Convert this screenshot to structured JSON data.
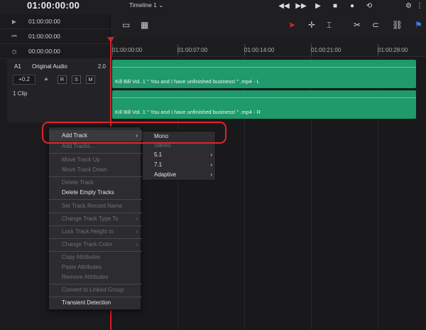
{
  "topbar": {
    "timecode": "01:00:00:00",
    "timeline_name": "Timeline 1",
    "transport": [
      "prev",
      "next",
      "play",
      "stop",
      "record",
      "loop"
    ]
  },
  "left": {
    "timecodes": [
      "01:00:00:00",
      "01:00:00:00",
      "00:00:00:00"
    ],
    "track": {
      "id": "A1",
      "name": "Original Audio",
      "level": "2.0",
      "volume": "+0.2",
      "buttons": [
        "R",
        "S",
        "M"
      ],
      "clips": "1 Clip"
    }
  },
  "ruler": {
    "ticks": [
      "01:00:00:00",
      "01:00:07:00",
      "01:00:14:00",
      "01:00:21:00",
      "01:00:28:00"
    ]
  },
  "clips": [
    {
      "label": "Kill Bill Vol. 1  \" You and I have unfinished business! \" .mp4 - L"
    },
    {
      "label": "Kill Bill Vol. 1  \" You and I have unfinished business! \" .mp4 - R"
    }
  ],
  "context_menu": {
    "items": [
      {
        "label": "Add Track",
        "disabled": false,
        "submenu": true
      },
      {
        "label": "Add Tracks...",
        "disabled": true,
        "submenu": false
      },
      {
        "label": "Move Track Up",
        "disabled": true,
        "submenu": false
      },
      {
        "label": "Move Track Down",
        "disabled": true,
        "submenu": false
      },
      {
        "label": "Delete Track",
        "disabled": true,
        "submenu": false
      },
      {
        "label": "Delete Empty Tracks",
        "disabled": false,
        "submenu": false
      },
      {
        "label": "Set Track Record Name",
        "disabled": true,
        "submenu": false
      },
      {
        "label": "Change Track Type To",
        "disabled": true,
        "submenu": true
      },
      {
        "label": "Lock Track Height to",
        "disabled": true,
        "submenu": true
      },
      {
        "label": "Change Track Color",
        "disabled": true,
        "submenu": true
      },
      {
        "label": "Copy Attributes",
        "disabled": true,
        "submenu": false
      },
      {
        "label": "Paste Attributes",
        "disabled": true,
        "submenu": false
      },
      {
        "label": "Remove Attributes",
        "disabled": true,
        "submenu": false
      },
      {
        "label": "Convert to Linked Group",
        "disabled": true,
        "submenu": false
      },
      {
        "label": "Transient Detection",
        "disabled": false,
        "submenu": false
      }
    ]
  },
  "submenu": {
    "items": [
      {
        "label": "Mono",
        "disabled": false,
        "submenu": false
      },
      {
        "label": "Stereo",
        "disabled": true,
        "submenu": false
      },
      {
        "label": "5.1",
        "disabled": false,
        "submenu": true
      },
      {
        "label": "7.1",
        "disabled": false,
        "submenu": true
      },
      {
        "label": "Adaptive",
        "disabled": false,
        "submenu": true
      }
    ]
  },
  "colors": {
    "clip": "#1f9a6b",
    "playhead": "#d61f2a",
    "highlight": "#e3222e"
  }
}
